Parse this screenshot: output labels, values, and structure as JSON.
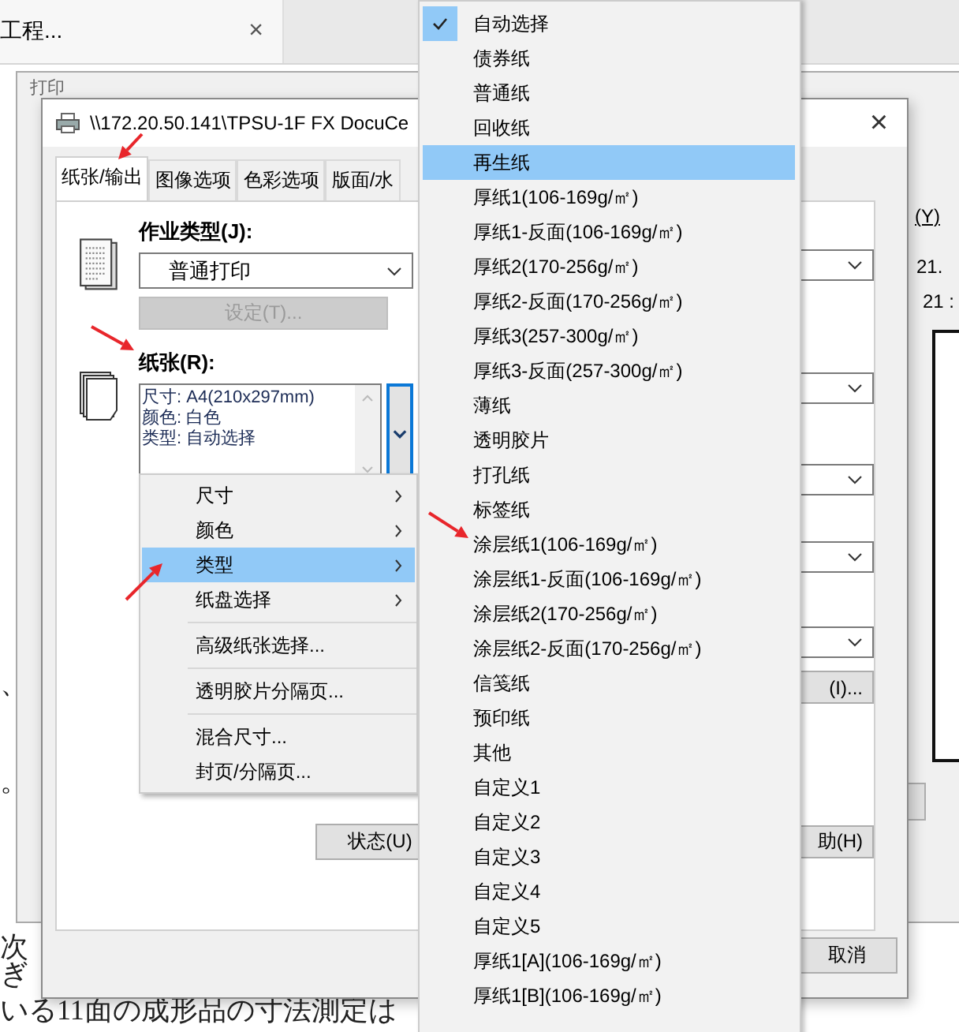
{
  "app_tab": {
    "title": "工程...",
    "close": "×"
  },
  "document_lines": [
    "、",
    "。",
    "次",
    "ぎ",
    "いる11面の成形品の寸法測定は"
  ],
  "back_dialog": {
    "title": "打印",
    "link": "(Y)",
    "readings": [
      "21.",
      "21 :"
    ]
  },
  "dialog": {
    "title": "\\\\172.20.50.141\\TPSU-1F FX DocuCe",
    "close": "×",
    "tabs": [
      {
        "label": "纸张/输出",
        "selected": true
      },
      {
        "label": "图像选项",
        "selected": false
      },
      {
        "label": "色彩选项",
        "selected": false
      },
      {
        "label": "版面/水",
        "selected": false
      }
    ],
    "job_type": {
      "label": "作业类型(J):",
      "value": "普通打印"
    },
    "settings_button": {
      "label": "设定(T)...",
      "disabled": true
    },
    "paper": {
      "label": "纸张(R):",
      "lines": [
        "尺寸: A4(210x297mm)",
        "颜色: 白色",
        "类型: 自动选择"
      ]
    },
    "status_button": "状态(U)",
    "right_buttons": [
      "(I)...",
      "助(H)"
    ],
    "footer_buttons": [
      "取消"
    ]
  },
  "paper_menu": {
    "items": [
      {
        "kind": "submenu",
        "label": "尺寸",
        "selected": false
      },
      {
        "kind": "submenu",
        "label": "颜色",
        "selected": false
      },
      {
        "kind": "submenu",
        "label": "类型",
        "selected": true
      },
      {
        "kind": "submenu",
        "label": "纸盘选择",
        "selected": false
      },
      {
        "kind": "separator"
      },
      {
        "kind": "item",
        "label": "高级纸张选择...",
        "selected": false
      },
      {
        "kind": "separator"
      },
      {
        "kind": "item",
        "label": "透明胶片分隔页...",
        "selected": false
      },
      {
        "kind": "separator"
      },
      {
        "kind": "item",
        "label": "混合尺寸...",
        "selected": false
      },
      {
        "kind": "item",
        "label": "封页/分隔页...",
        "selected": false
      }
    ]
  },
  "type_menu": {
    "items": [
      {
        "label": "自动选择",
        "checked": true,
        "selected": false
      },
      {
        "label": "债券纸",
        "checked": false,
        "selected": false
      },
      {
        "label": "普通纸",
        "checked": false,
        "selected": false
      },
      {
        "label": "回收纸",
        "checked": false,
        "selected": false
      },
      {
        "label": "再生纸",
        "checked": false,
        "selected": true
      },
      {
        "label": "厚纸1(106-169g/㎡)",
        "checked": false,
        "selected": false
      },
      {
        "label": "厚纸1-反面(106-169g/㎡)",
        "checked": false,
        "selected": false
      },
      {
        "label": "厚纸2(170-256g/㎡)",
        "checked": false,
        "selected": false
      },
      {
        "label": "厚纸2-反面(170-256g/㎡)",
        "checked": false,
        "selected": false
      },
      {
        "label": "厚纸3(257-300g/㎡)",
        "checked": false,
        "selected": false
      },
      {
        "label": "厚纸3-反面(257-300g/㎡)",
        "checked": false,
        "selected": false
      },
      {
        "label": "薄纸",
        "checked": false,
        "selected": false
      },
      {
        "label": "透明胶片",
        "checked": false,
        "selected": false
      },
      {
        "label": "打孔纸",
        "checked": false,
        "selected": false
      },
      {
        "label": "标签纸",
        "checked": false,
        "selected": false
      },
      {
        "label": "涂层纸1(106-169g/㎡)",
        "checked": false,
        "selected": false
      },
      {
        "label": "涂层纸1-反面(106-169g/㎡)",
        "checked": false,
        "selected": false
      },
      {
        "label": "涂层纸2(170-256g/㎡)",
        "checked": false,
        "selected": false
      },
      {
        "label": "涂层纸2-反面(170-256g/㎡)",
        "checked": false,
        "selected": false
      },
      {
        "label": "信笺纸",
        "checked": false,
        "selected": false
      },
      {
        "label": "预印纸",
        "checked": false,
        "selected": false
      },
      {
        "label": "其他",
        "checked": false,
        "selected": false
      },
      {
        "label": "自定义1",
        "checked": false,
        "selected": false
      },
      {
        "label": "自定义2",
        "checked": false,
        "selected": false
      },
      {
        "label": "自定义3",
        "checked": false,
        "selected": false
      },
      {
        "label": "自定义4",
        "checked": false,
        "selected": false
      },
      {
        "label": "自定义5",
        "checked": false,
        "selected": false
      },
      {
        "label": "厚纸1[A](106-169g/㎡)",
        "checked": false,
        "selected": false
      },
      {
        "label": "厚纸1[B](106-169g/㎡)",
        "checked": false,
        "selected": false
      }
    ]
  }
}
